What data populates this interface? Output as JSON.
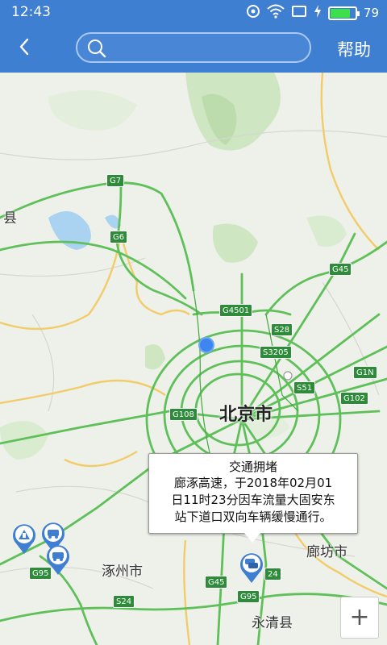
{
  "status_bar": {
    "time": "12:43",
    "battery_level": "79",
    "battery_fraction": 0.79,
    "icons": [
      "notification-icon",
      "wifi-icon",
      "screen-icon",
      "charging-icon",
      "battery-icon"
    ]
  },
  "toolbar": {
    "back_icon": "chevron-left-icon",
    "search_icon": "search-icon",
    "search_value": "",
    "help_label": "帮助"
  },
  "map": {
    "places": {
      "beijing": "北京市",
      "langfang": "廊坊市",
      "zhuozhou": "涿州市",
      "yongqing": "永清县",
      "left_county": "县"
    },
    "shields": {
      "g7": "G7",
      "g6": "G6",
      "g45_top": "G45",
      "g4501": "G4501",
      "s28": "S28",
      "s3205": "S3205",
      "g1n": "G1N",
      "s51": "S51",
      "g102": "G102",
      "g108": "G108",
      "g95_left": "G95",
      "s24_left": "S24",
      "g45_bottom": "G45",
      "s24_right": "24",
      "g95_bottom": "G95"
    },
    "popup": {
      "title": "交通拥堵",
      "line1": "廊涿高速，于2018年02月01",
      "line2": "日11时23分因车流量大固安东",
      "line3": "站下道口双向车辆缓慢通行。"
    },
    "zoom_in_label": "+",
    "colors": {
      "highway": "#5fc05a",
      "arterial": "#f2cc6a",
      "accent": "#3f7fd2",
      "marker": "#3f7fd2"
    }
  }
}
